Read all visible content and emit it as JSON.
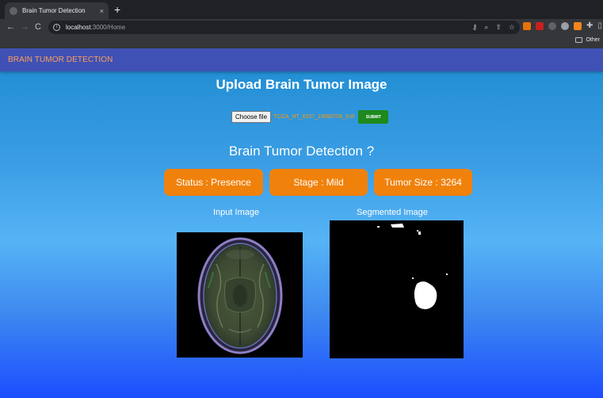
{
  "browser": {
    "tab_title": "Brain Tumor Detection",
    "tab_close": "×",
    "new_tab": "+",
    "back": "←",
    "forward": "→",
    "reload": "C",
    "url_host": "localhost",
    "url_path": ":3000/Home",
    "bookmark_other": "Other"
  },
  "app": {
    "brand": "BRAIN TUMOR DETECTION"
  },
  "upload": {
    "title": "Upload Brain Tumor Image",
    "choose_label": "Choose file",
    "filename": "TCGA_HT_8107_19980708_9.tif",
    "submit_label": "SUBMIT"
  },
  "result": {
    "title": "Brain Tumor Detection ?",
    "status": "Status : Presence",
    "stage": "Stage : Mild",
    "size": "Tumor Size : 3264"
  },
  "images": {
    "input_label": "Input Image",
    "segmented_label": "Segmented Image"
  },
  "colors": {
    "appbar": "#3f51b5",
    "brand": "#ff9f5a",
    "pill": "#f0820c",
    "submit": "#1e8a1e"
  }
}
